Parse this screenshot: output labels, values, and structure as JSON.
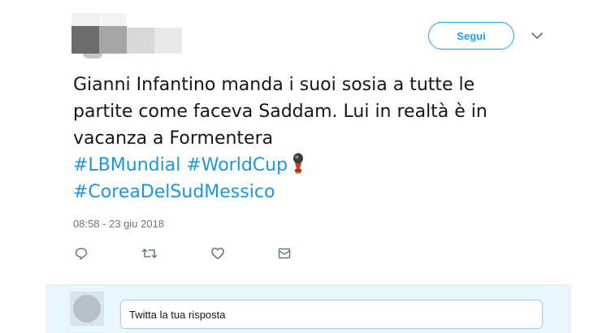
{
  "header": {
    "follow_label": "Segui",
    "more_icon": "chevron-down-icon"
  },
  "tweet": {
    "text_lines": [
      "Gianni Infantino manda i suoi sosia a tutte le",
      "partite come faceva Saddam. Lui in realtà è in",
      "vacanza a Formentera"
    ],
    "hashtags": [
      "#LBMundial",
      "#WorldCup",
      "#CoreaDelSudMessico"
    ],
    "emoji": "world-cup-trophy-icon",
    "timestamp": "08:58 - 23 giu 2018"
  },
  "actions": [
    {
      "name": "reply",
      "icon": "reply-icon"
    },
    {
      "name": "retweet",
      "icon": "retweet-icon"
    },
    {
      "name": "like",
      "icon": "heart-icon"
    },
    {
      "name": "direct-message",
      "icon": "envelope-icon"
    }
  ],
  "reply_box": {
    "placeholder": "Twitta la tua risposta"
  },
  "colors": {
    "accent": "#1da1f2",
    "hashtag": "#1b95e0",
    "muted": "#657786",
    "reply_bg": "#e8f5fd"
  }
}
